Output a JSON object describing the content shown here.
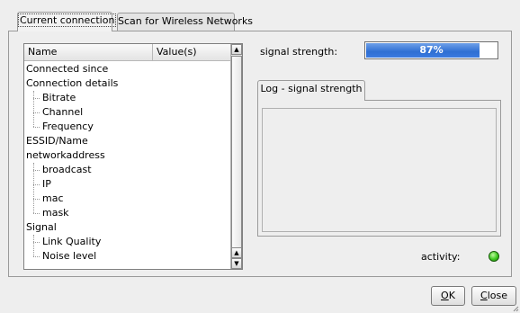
{
  "tabs": [
    "Current connection",
    "Scan for Wireless Networks"
  ],
  "tree": {
    "headers": [
      "Name",
      "Value(s)"
    ],
    "rows": [
      {
        "label": "Connected since",
        "level": 0
      },
      {
        "label": "Connection details",
        "level": 0
      },
      {
        "label": "Bitrate",
        "level": 1
      },
      {
        "label": "Channel",
        "level": 1
      },
      {
        "label": "Frequency",
        "level": 1
      },
      {
        "label": "ESSID/Name",
        "level": 0
      },
      {
        "label": "networkaddress",
        "level": 0
      },
      {
        "label": "broadcast",
        "level": 1
      },
      {
        "label": "IP",
        "level": 1
      },
      {
        "label": "mac",
        "level": 1
      },
      {
        "label": "mask",
        "level": 1
      },
      {
        "label": "Signal",
        "level": 0
      },
      {
        "label": "Link Quality",
        "level": 1
      },
      {
        "label": "Noise level",
        "level": 1
      }
    ]
  },
  "signal": {
    "label": "signal strength:",
    "percent": 87,
    "text": "87%"
  },
  "log_tab": "Log - signal strength",
  "activity": {
    "label": "activity:",
    "color": "#3cc81e"
  },
  "buttons": {
    "ok": "OK",
    "close": "Close"
  }
}
